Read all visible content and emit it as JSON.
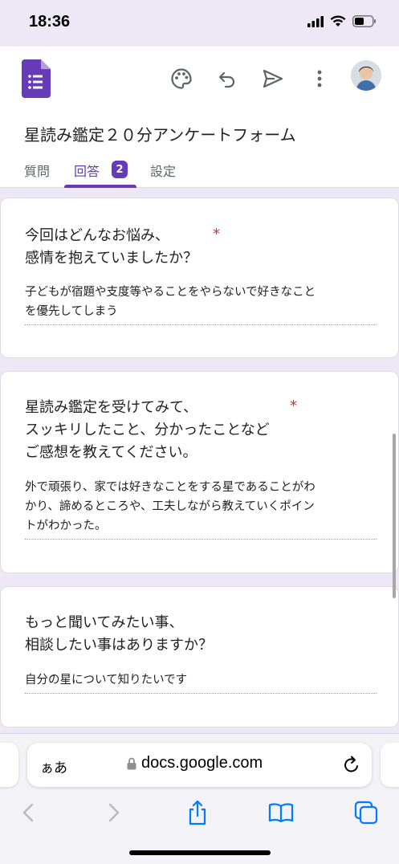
{
  "status_bar": {
    "time": "18:36"
  },
  "header": {
    "form_title": "星読み鑑定２０分アンケートフォーム",
    "tabs": [
      {
        "label": "質問",
        "active": false
      },
      {
        "label": "回答",
        "active": true,
        "badge": "2"
      },
      {
        "label": "設定",
        "active": false
      }
    ],
    "icons": [
      "palette-icon",
      "undo-icon",
      "send-icon",
      "more-vert-icon"
    ],
    "accent_color": "#673ab7"
  },
  "responses": [
    {
      "question_lines": [
        "今回はどんなお悩み、",
        "感情を抱えていましたか？"
      ],
      "required_mark": "*",
      "answer_lines": [
        "子どもが宿題や支度等やることをやらないで好きなこと",
        "を優先してしまう"
      ]
    },
    {
      "question_lines": [
        "星読み鑑定を受けてみて、",
        "スッキリしたこと、分かったことなど",
        "ご感想を教えてください。"
      ],
      "required_mark": "*",
      "answer_lines": [
        "外で頑張り、家では好きなことをする星であることがわ",
        "かり、諦めるところや、工夫しながら教えていくポイン",
        "トがわかった。"
      ]
    },
    {
      "question_lines": [
        "もっと聞いてみたい事、",
        "相談したい事はありますか？"
      ],
      "answer_lines": [
        "自分の星について知りたいです"
      ]
    }
  ],
  "browser": {
    "aa_label": "ぁあ",
    "url": "docs.google.com"
  }
}
